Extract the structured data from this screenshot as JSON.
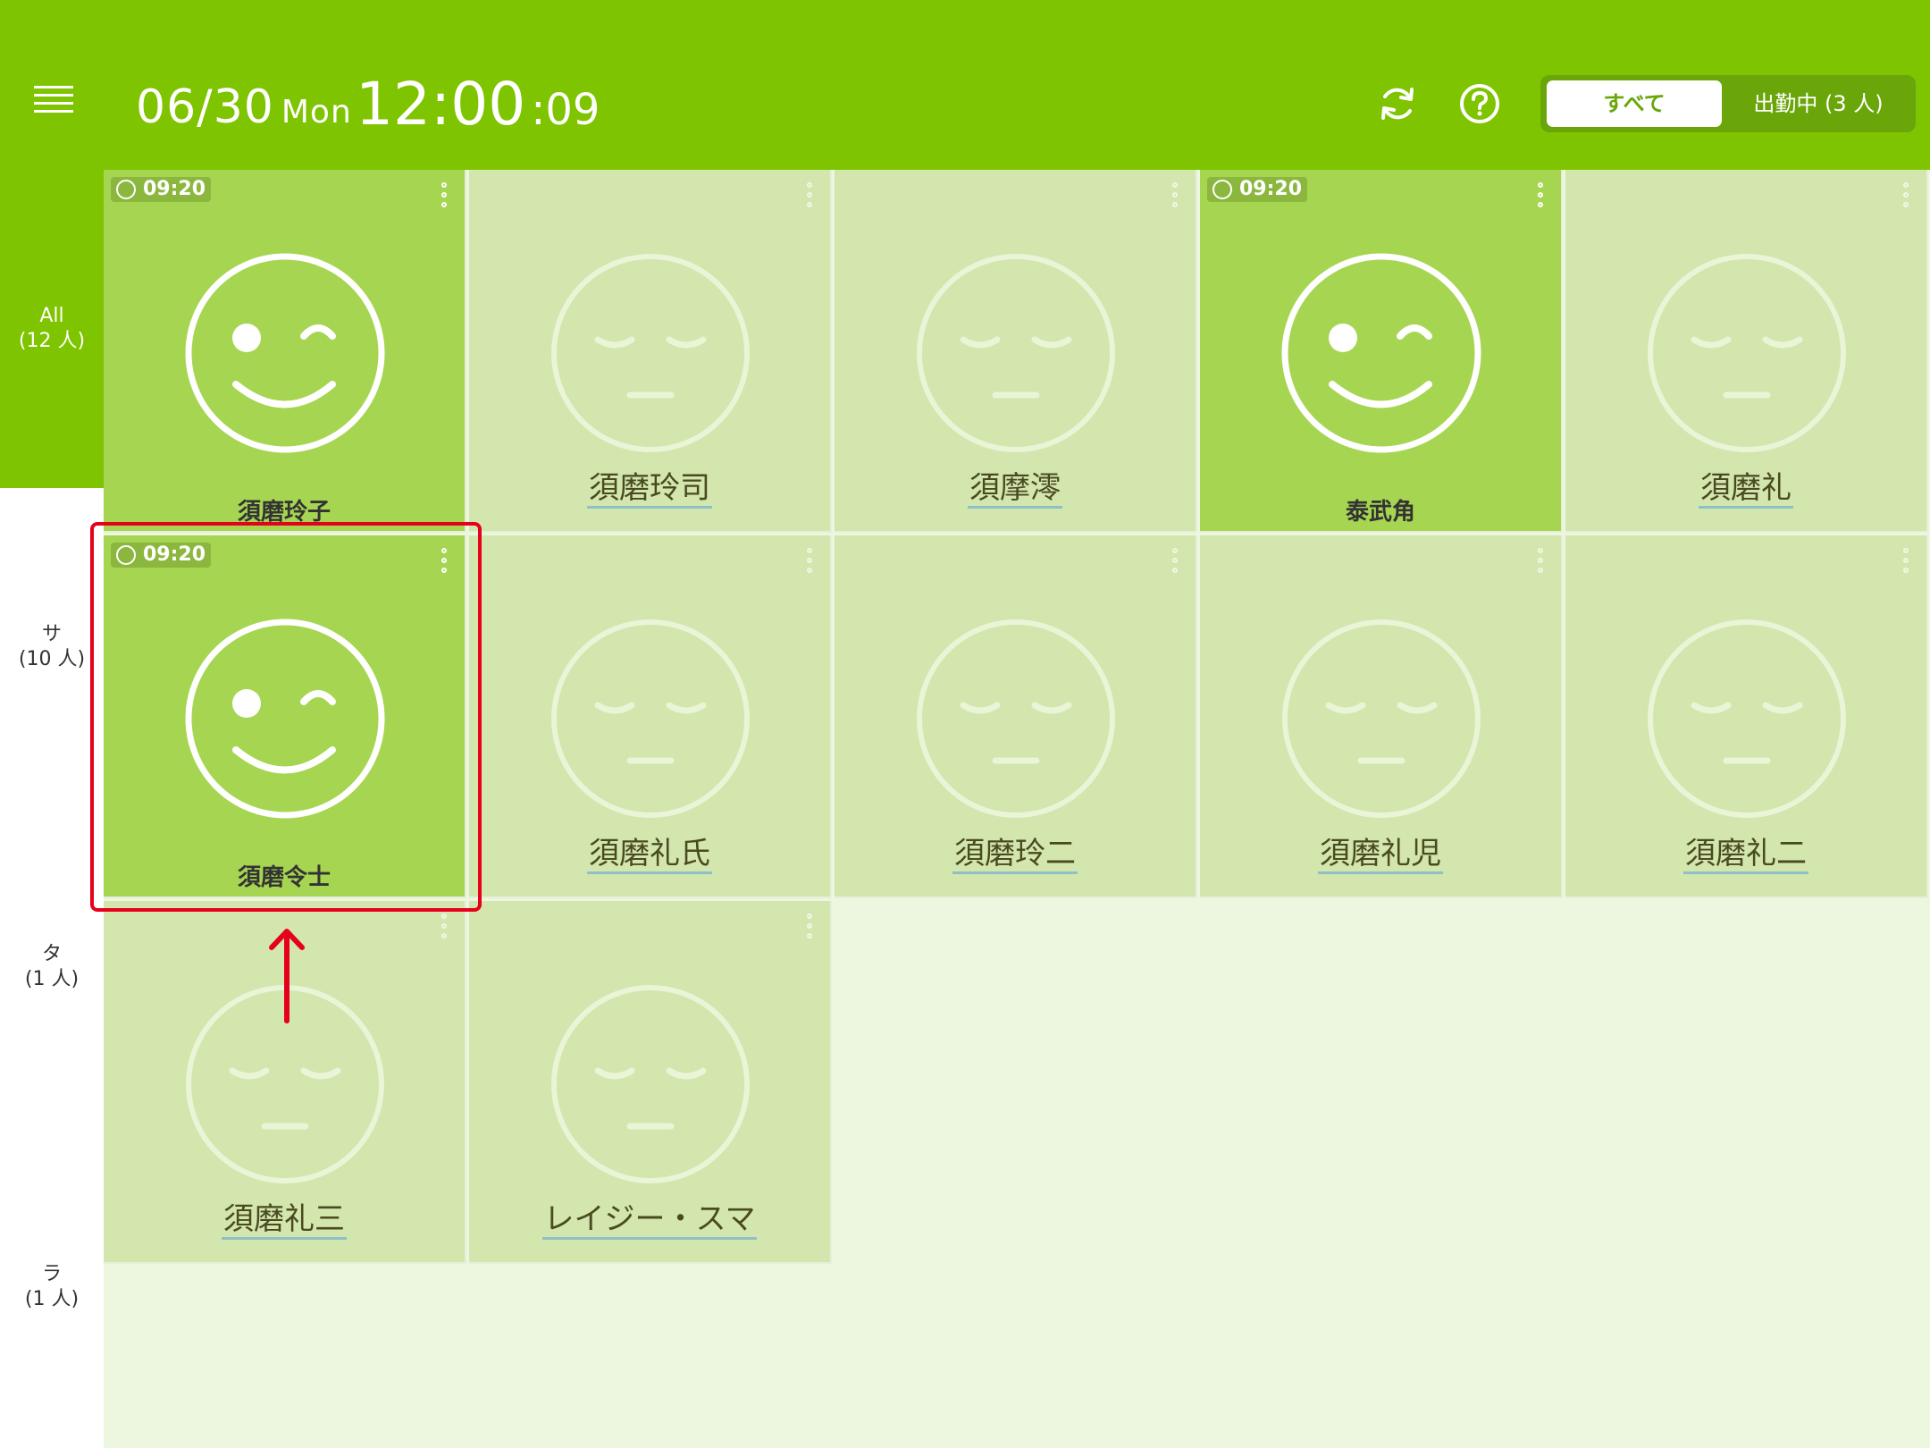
{
  "header": {
    "date": "06/30",
    "weekday": "Mon",
    "time": "12:00",
    "seconds": ":09",
    "filter": {
      "all_label": "すべて",
      "working_label": "出勤中 (3 人)",
      "selected": "all"
    }
  },
  "sidebar": {
    "items": [
      {
        "label": "All",
        "count": "(12 人)",
        "active": true
      },
      {
        "label": "サ",
        "count": "(10 人)",
        "active": false
      },
      {
        "label": "タ",
        "count": "(1 人)",
        "active": false
      },
      {
        "label": "ラ",
        "count": "(1 人)",
        "active": false
      }
    ]
  },
  "staff": [
    {
      "name": "須磨玲子",
      "status": "clocked-in",
      "time": "09:20"
    },
    {
      "name": "須磨玲司",
      "status": "off"
    },
    {
      "name": "須摩澪",
      "status": "off"
    },
    {
      "name": "泰武角",
      "status": "clocked-in",
      "time": "09:20"
    },
    {
      "name": "須磨礼",
      "status": "off"
    },
    {
      "name": "須磨令士",
      "status": "clocked-in",
      "time": "09:20"
    },
    {
      "name": "須磨礼氏",
      "status": "off"
    },
    {
      "name": "須磨玲二",
      "status": "off"
    },
    {
      "name": "須磨礼児",
      "status": "off"
    },
    {
      "name": "須磨礼二",
      "status": "off"
    },
    {
      "name": "須磨礼三",
      "status": "off"
    },
    {
      "name": "レイジー・スマ",
      "status": "off"
    }
  ],
  "icons": {
    "menu": "hamburger-menu-icon",
    "refresh": "refresh-icon",
    "help": "help-circle-icon",
    "clock": "clock-icon",
    "more": "vertical-ellipsis-icon",
    "face_on": "winking-face-icon",
    "face_off": "sleeping-face-icon"
  },
  "colors": {
    "brand": "#7ec400",
    "card_on": "#a6d551",
    "card_off": "#d2e6ae",
    "grid_bg": "#edf6df",
    "highlight": "#e5001c"
  }
}
